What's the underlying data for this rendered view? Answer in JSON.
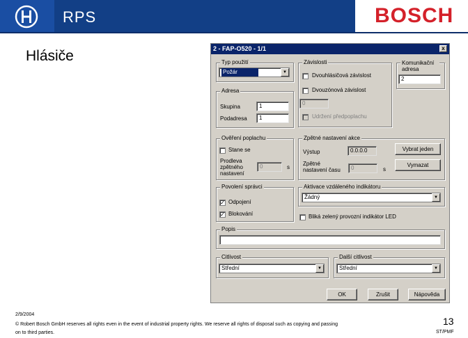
{
  "header": {
    "app_name": "RPS",
    "brand": "BOSCH"
  },
  "slide": {
    "title": "Hlásiče"
  },
  "dialog": {
    "title": "2 - FAP-O520 - 1/1",
    "close_glyph": "x",
    "typ": {
      "label": "Typ použití",
      "value": "Požár"
    },
    "zavislosti": {
      "label": "Závislosti",
      "dvouhlasicova": "Dvouhlásičová závislost",
      "dvouzonova": "Dvouzónová závislost",
      "zone_value": "0",
      "udrzeni": "Udržení předpoplachu"
    },
    "komunikacni": {
      "label": "Komunikační adresa",
      "value": "2"
    },
    "adresa": {
      "label": "Adresa",
      "skupina_label": "Skupina",
      "skupina_value": "1",
      "podadresa_label": "Podadresa",
      "podadresa_value": "1"
    },
    "overeni": {
      "label": "Ověření poplachu",
      "stane_se": "Stane se",
      "prodleva_label": "Prodleva zpětného nastavení",
      "prodleva_value": "0",
      "unit": "s"
    },
    "zpetne": {
      "label": "Zpětné nastavení akce",
      "vystup_label": "Výstup",
      "vystup_value": "0.0.0.0",
      "cas_label": "Zpětné nastavení času",
      "cas_value": "0",
      "unit": "s",
      "vybrat": "Vybrat jeden",
      "vymazat": "Vymazat"
    },
    "povoleni": {
      "label": "Povolení správci",
      "odpojeni": "Odpojení",
      "blokovani": "Blokování"
    },
    "aktivace": {
      "label": "Aktivace vzdáleného indikátoru",
      "value": "Žádný",
      "blika": "Bliká zelený provozní indikátor LED"
    },
    "popis": {
      "label": "Popis",
      "value": ""
    },
    "citlivost": {
      "label": "Citlivost",
      "value": "Střední"
    },
    "dalsi": {
      "label": "Další citlivost",
      "value": "Střední"
    },
    "buttons": {
      "ok": "OK",
      "zrusit": "Zrušit",
      "napoveda": "Nápověda"
    },
    "check_glyph": "✓"
  },
  "footer": {
    "date": "2/9/2004",
    "copyright": "© Robert Bosch GmbH reserves all rights even in the event of industrial property rights. We reserve all rights of disposal such as copying and passing on to third parties.",
    "page_number": "13",
    "code": "ST/PMF"
  },
  "colors": {
    "header_blue": "#123f86",
    "brand_red": "#d4212a",
    "dialog_gray": "#d4d0c8",
    "title_blue": "#0a246a"
  }
}
